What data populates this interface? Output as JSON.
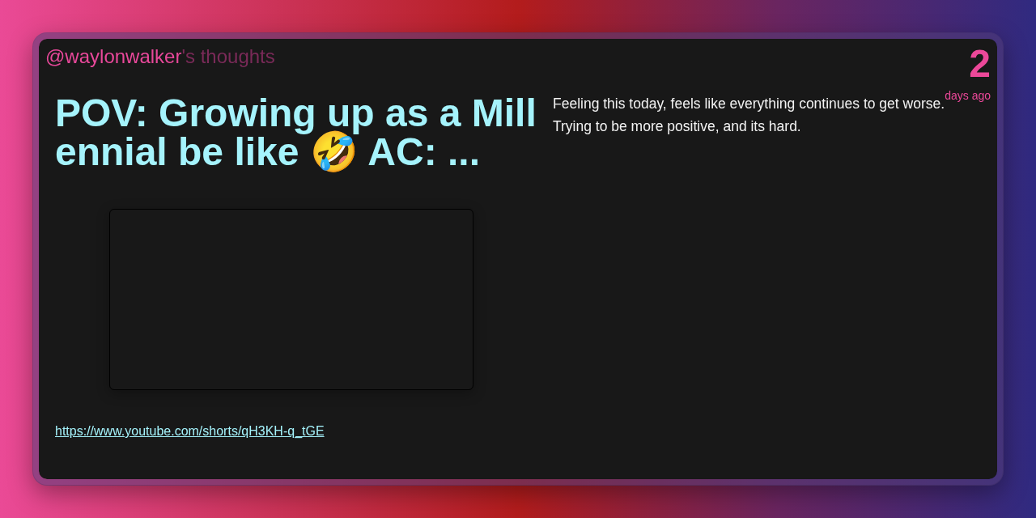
{
  "header": {
    "author": "@waylonwalker",
    "suffix": "'s thoughts"
  },
  "age": {
    "number": "2",
    "unit": "days ago"
  },
  "post": {
    "title": "POV: Growing up as a Millennial be like 🤣 AC: ...",
    "video": {
      "kind": "embed"
    },
    "link": "https://www.youtube.com/shorts/qH3KH-q_tGE"
  },
  "comment": [
    "Feeling this today, feels like everything continues to get worse.",
    "Trying to be more positive, and its hard."
  ]
}
